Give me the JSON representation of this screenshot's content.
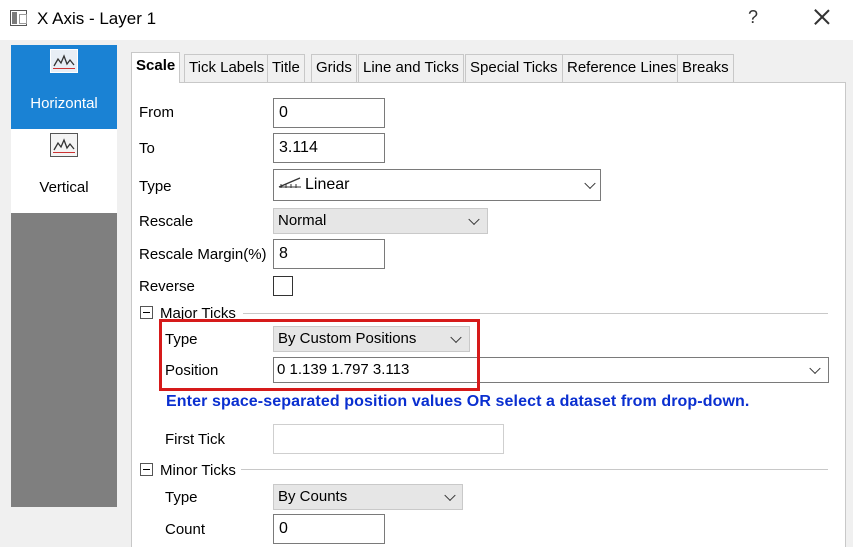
{
  "window": {
    "title": "X Axis - Layer 1",
    "help_glyph": "?"
  },
  "sidebar": {
    "items": [
      {
        "label": "Horizontal",
        "icon": "horizontal-axis-icon",
        "active": true
      },
      {
        "label": "Vertical",
        "icon": "vertical-axis-icon",
        "active": false
      }
    ]
  },
  "tabs": [
    "Scale",
    "Tick Labels",
    "Title",
    "Grids",
    "Line and Ticks",
    "Special Ticks",
    "Reference Lines",
    "Breaks"
  ],
  "scale": {
    "from_label": "From",
    "from_value": "0",
    "to_label": "To",
    "to_value": "3.114",
    "type_label": "Type",
    "type_value": "Linear",
    "rescale_label": "Rescale",
    "rescale_value": "Normal",
    "rescale_margin_label": "Rescale Margin(%)",
    "rescale_margin_value": "8",
    "reverse_label": "Reverse"
  },
  "major_ticks": {
    "header": "Major Ticks",
    "type_label": "Type",
    "type_value": "By Custom Positions",
    "position_label": "Position",
    "position_value": "0 1.139 1.797 3.113",
    "hint": "Enter space-separated position values OR select a dataset from drop-down.",
    "first_tick_label": "First Tick",
    "first_tick_value": ""
  },
  "minor_ticks": {
    "header": "Minor Ticks",
    "type_label": "Type",
    "type_value": "By Counts",
    "count_label": "Count",
    "count_value": "0"
  },
  "colors": {
    "accent": "#1a82d4",
    "highlight": "#d61a1a",
    "hint": "#0a2fd0"
  }
}
